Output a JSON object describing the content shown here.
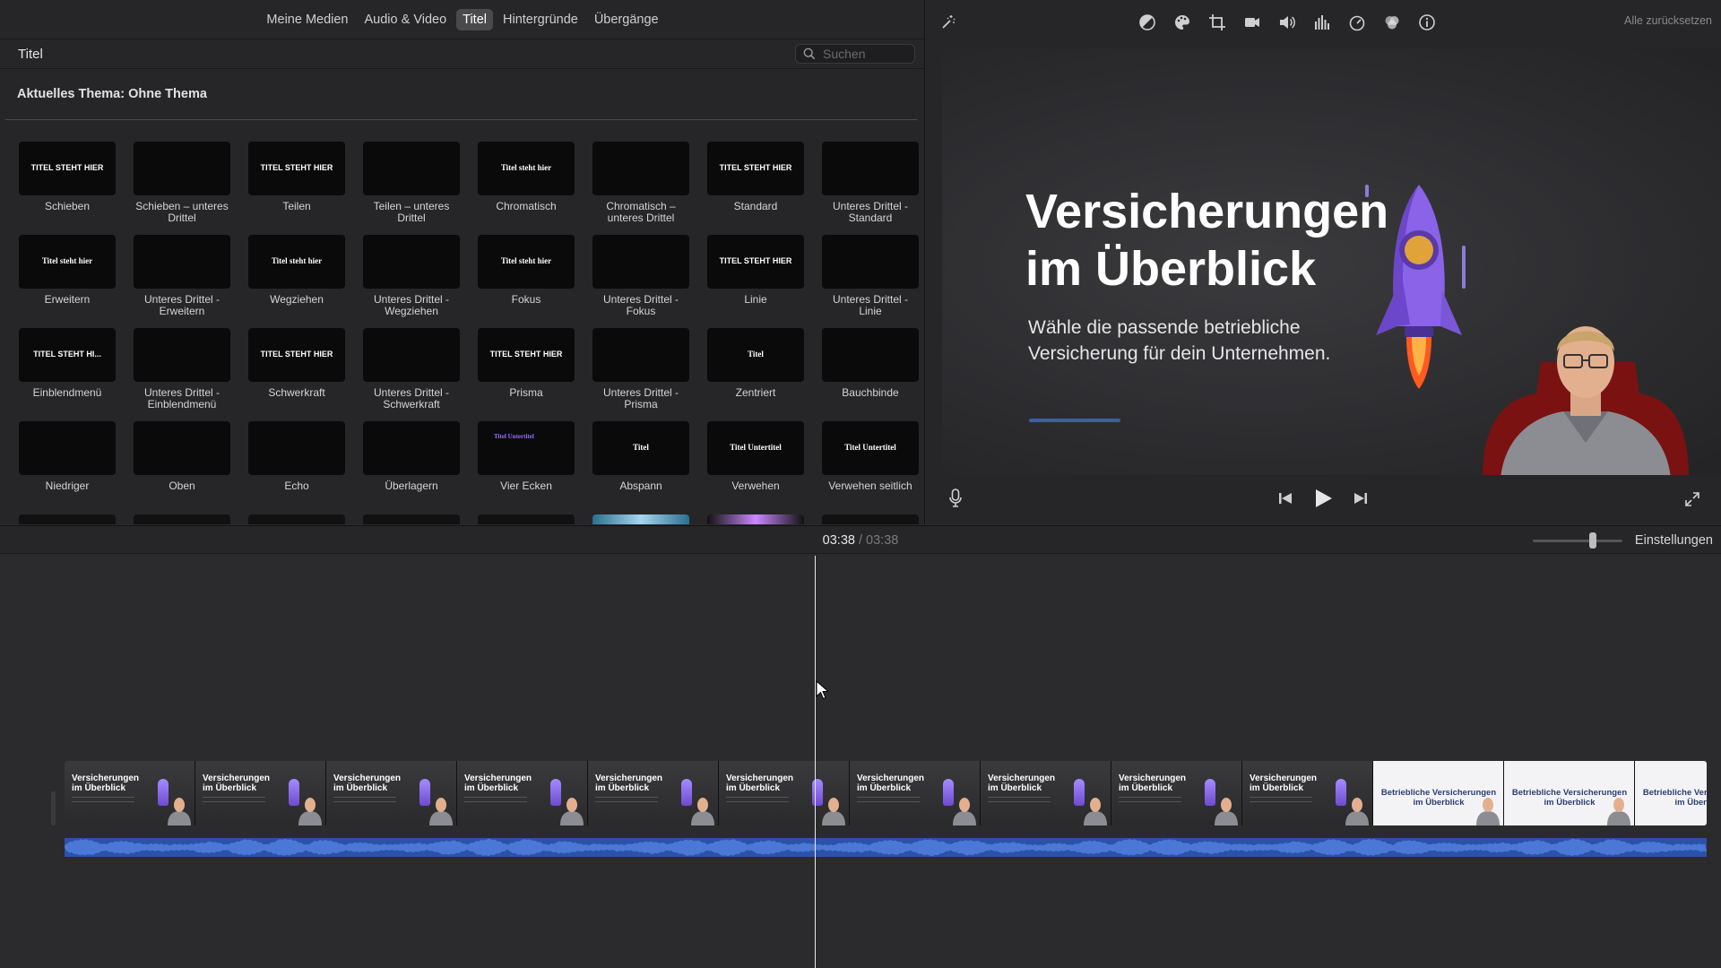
{
  "library_tabs": [
    "Meine Medien",
    "Audio & Video",
    "Titel",
    "Hintergründe",
    "Übergänge"
  ],
  "active_tab": "Titel",
  "browser": {
    "title": "Titel",
    "search_placeholder": "Suchen",
    "theme_label": "Aktuelles Thema: Ohne Thema"
  },
  "titles": [
    {
      "label": "Schieben",
      "thumb": "TITEL STEHT HIER"
    },
    {
      "label": "Schieben – unteres Drittel",
      "thumb": ""
    },
    {
      "label": "Teilen",
      "thumb": "TITEL STEHT HIER"
    },
    {
      "label": "Teilen – unteres Drittel",
      "thumb": ""
    },
    {
      "label": "Chromatisch",
      "thumb": "Titel steht hier"
    },
    {
      "label": "Chromatisch – unteres Drittel",
      "thumb": ""
    },
    {
      "label": "Standard",
      "thumb": "TITEL STEHT HIER"
    },
    {
      "label": "Unteres Drittel - Standard",
      "thumb": ""
    },
    {
      "label": "Erweitern",
      "thumb": "Titel steht hier"
    },
    {
      "label": "Unteres Drittel - Erweitern",
      "thumb": ""
    },
    {
      "label": "Wegziehen",
      "thumb": "Titel steht hier"
    },
    {
      "label": "Unteres Drittel - Wegziehen",
      "thumb": ""
    },
    {
      "label": "Fokus",
      "thumb": "Titel steht hier"
    },
    {
      "label": "Unteres Drittel - Fokus",
      "thumb": ""
    },
    {
      "label": "Linie",
      "thumb": "TITEL STEHT HIER"
    },
    {
      "label": "Unteres Drittel - Linie",
      "thumb": ""
    },
    {
      "label": "Einblendmenü",
      "thumb": "TITEL STEHT HI..."
    },
    {
      "label": "Unteres Drittel - Einblendmenü",
      "thumb": ""
    },
    {
      "label": "Schwerkraft",
      "thumb": "TITEL STEHT HIER"
    },
    {
      "label": "Unteres Drittel - Schwerkraft",
      "thumb": ""
    },
    {
      "label": "Prisma",
      "thumb": "TITEL STEHT HIER"
    },
    {
      "label": "Unteres Drittel - Prisma",
      "thumb": ""
    },
    {
      "label": "Zentriert",
      "thumb": "Titel"
    },
    {
      "label": "Bauchbinde",
      "thumb": ""
    },
    {
      "label": "Niedriger",
      "thumb": ""
    },
    {
      "label": "Oben",
      "thumb": ""
    },
    {
      "label": "Echo",
      "thumb": ""
    },
    {
      "label": "Überlagern",
      "thumb": ""
    },
    {
      "label": "Vier Ecken",
      "thumb": "Titel Untertitel"
    },
    {
      "label": "Abspann",
      "thumb": "Titel"
    },
    {
      "label": "Verwehen",
      "thumb": "Titel Untertitel"
    },
    {
      "label": "Verwehen seitlich",
      "thumb": "Titel Untertitel"
    }
  ],
  "viewer": {
    "reset_label": "Alle zurücksetzen",
    "video_title": "Versicherungen\nim Überblick",
    "video_subtitle": "Wähle die passende betriebliche\nVersicherung für dein Unternehmen.",
    "toolbar_icons": [
      "magic-wand-icon",
      "color-balance-icon",
      "color-correction-icon",
      "crop-icon",
      "stabilization-icon",
      "volume-icon",
      "noise-reduction-icon",
      "speed-icon",
      "clip-filter-icon",
      "info-icon"
    ]
  },
  "timeline": {
    "current_time": "03:38",
    "separator": "/",
    "total_time": "03:38",
    "settings_label": "Einstellungen",
    "frames": [
      {
        "title": "Versicherungen\nim Überblick",
        "style": "dark"
      },
      {
        "title": "Versicherungen\nim Überblick",
        "style": "dark"
      },
      {
        "title": "Versicherungen\nim Überblick",
        "style": "dark"
      },
      {
        "title": "Versicherungen\nim Überblick",
        "style": "dark"
      },
      {
        "title": "Versicherungen\nim Überblick",
        "style": "dark"
      },
      {
        "title": "Versicherungen\nim Überblick",
        "style": "dark"
      },
      {
        "title": "Versicherungen\nim Überblick",
        "style": "dark"
      },
      {
        "title": "Versicherungen\nim Überblick",
        "style": "dark"
      },
      {
        "title": "Versicherungen\nim Überblick",
        "style": "dark"
      },
      {
        "title": "Versicherungen\nim Überblick",
        "style": "dark"
      },
      {
        "title": "Betriebliche Versicherungen\nim Überblick",
        "style": "light"
      },
      {
        "title": "Betriebliche Versicherungen\nim Überblick",
        "style": "light"
      },
      {
        "title": "Betriebliche Versicherungen\nim Überblick",
        "style": "light"
      }
    ]
  },
  "colors": {
    "accent_blue": "#2c52a8",
    "progress_bar": "#3c5fa6",
    "rocket_purple": "#7f5ae0"
  }
}
